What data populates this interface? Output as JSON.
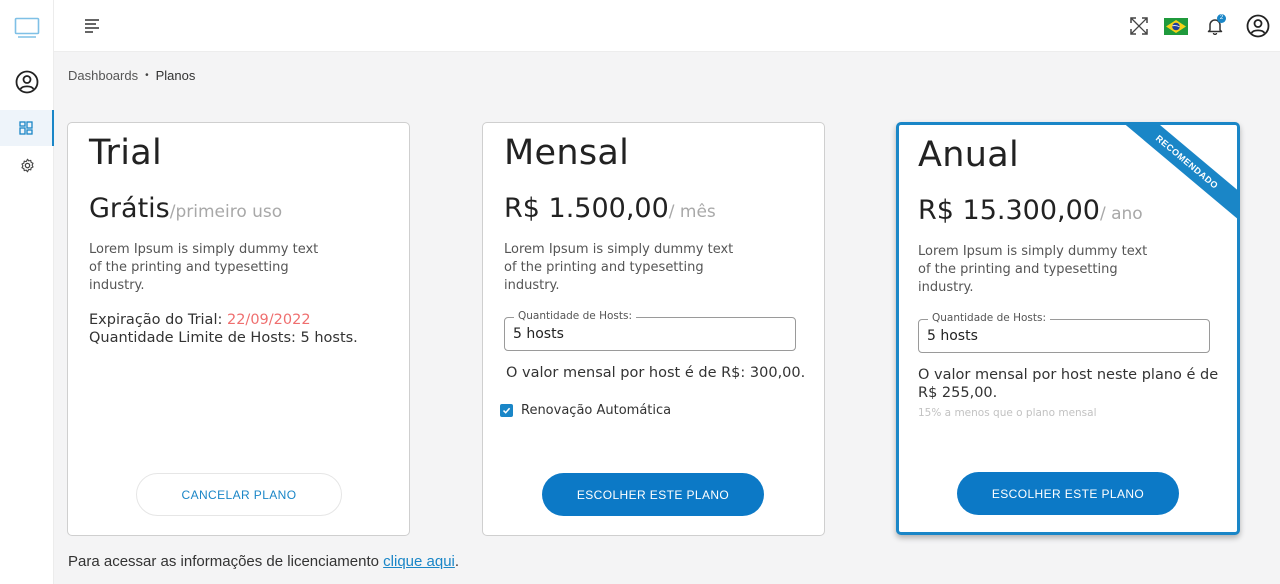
{
  "colors": {
    "accent": "#1a86c7",
    "button": "#0c79c6",
    "expiry": "#ef6f6f"
  },
  "topbar": {
    "notification_count": "2",
    "language": "Brasil"
  },
  "breadcrumb": {
    "items": [
      "Dashboards",
      "Planos"
    ],
    "separator": "•"
  },
  "plans": {
    "trial": {
      "title": "Trial",
      "price": "Grátis",
      "price_unit": "/primeiro uso",
      "description": "Lorem Ipsum is simply dummy text of the printing and typesetting industry.",
      "expiration_label": "Expiração do Trial: ",
      "expiration_date": "22/09/2022",
      "host_limit": "Quantidade Limite de Hosts: 5 hosts.",
      "button": "CANCELAR PLANO"
    },
    "mensal": {
      "title": "Mensal",
      "price": "R$ 1.500,00",
      "price_unit": "/ mês",
      "description": "Lorem Ipsum is simply dummy text of the printing and typesetting industry.",
      "qty_label": "Quantidade de Hosts:",
      "qty_value": "5 hosts",
      "host_text": "O valor mensal por host é de R$: 300,00.",
      "auto_renew_label": "Renovação Automática",
      "auto_renew_checked": true,
      "button": "ESCOLHER ESTE PLANO"
    },
    "anual": {
      "title": "Anual",
      "ribbon": "RECOMENDADO",
      "price": "R$ 15.300,00",
      "price_unit": "/ ano",
      "description": "Lorem Ipsum is simply dummy text of the printing and typesetting industry.",
      "qty_label": "Quantidade de Hosts:",
      "qty_value": "5 hosts",
      "host_text": "O valor mensal por host neste plano é de R$ 255,00.",
      "discount_note": "15% a menos que o plano mensal",
      "button": "ESCOLHER ESTE PLANO"
    }
  },
  "footer": {
    "text": "Para acessar as informações de licenciamento ",
    "link": "clique aqui",
    "suffix": "."
  }
}
